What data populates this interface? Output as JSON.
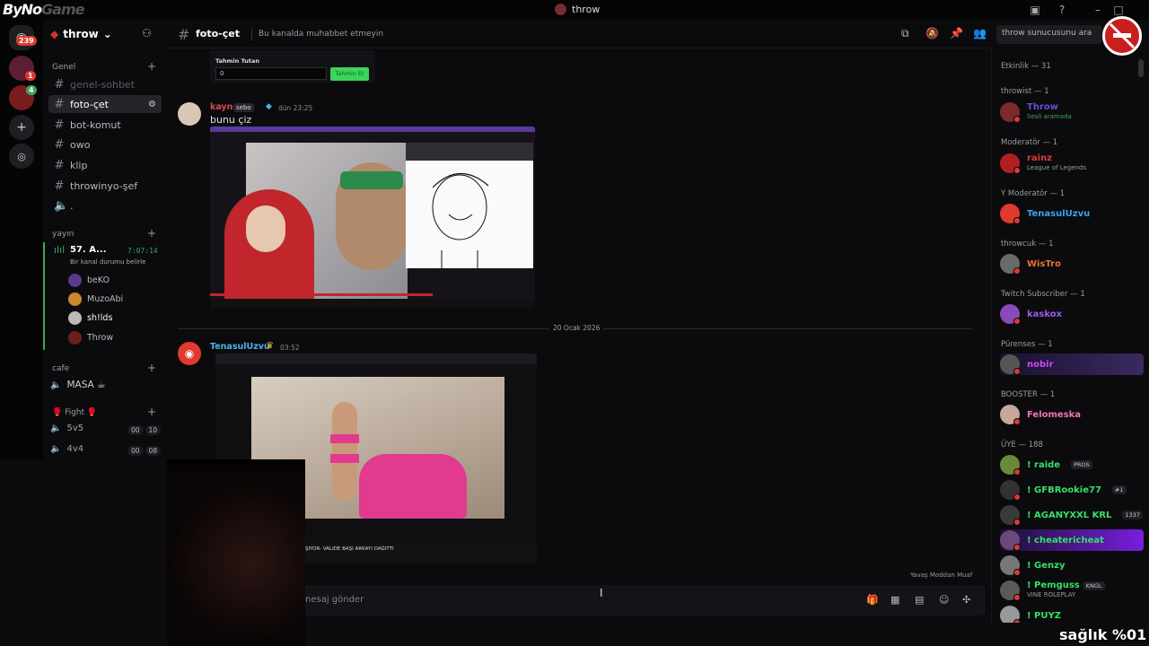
{
  "window": {
    "brand_main": "ByNo",
    "brand_game": "Game",
    "title": "throw"
  },
  "rail": {
    "home_badge": "239",
    "server2_badge": "1",
    "server3_badge": "4"
  },
  "guild": {
    "name": "throw",
    "chevron": "⌄"
  },
  "categories": {
    "genel": "Genel",
    "yayin": "yayın",
    "cafe": "cafe",
    "fight": "🥊 Fight 🥊"
  },
  "channels": [
    {
      "label": "genel-sohbet",
      "icon": "#",
      "state": "muted"
    },
    {
      "label": "foto-çet",
      "icon": "#",
      "state": "active"
    },
    {
      "label": "bot-komut",
      "icon": "#",
      "state": "normal"
    },
    {
      "label": "owo",
      "icon": "#",
      "state": "normal"
    },
    {
      "label": "klip",
      "icon": "#",
      "state": "normal"
    },
    {
      "label": "throwinyo-şef",
      "icon": "#",
      "state": "normal"
    },
    {
      "label": ".",
      "icon": "🔈",
      "state": "normal"
    }
  ],
  "voice_channel": {
    "name": "57. A...",
    "timer": "7:07:14",
    "status": "Bir kanal durumu belirle",
    "users": [
      "beKO",
      "MuzoAbi",
      "sh!lds",
      "Throw"
    ]
  },
  "cafe_channel": {
    "name": "MASA ☕"
  },
  "fight_channels": [
    {
      "name": "5v5",
      "count": "00",
      "limit": "10"
    },
    {
      "name": "4v4",
      "count": "00",
      "limit": "08"
    }
  ],
  "header": {
    "channel_name": "foto-çet",
    "topic": "Bu kanalda muhabbet etmeyin",
    "search_placeholder": "throw sunucusunu ara"
  },
  "game_card": {
    "label": "Tahmin Tutan",
    "input_value": "0",
    "button": "Tahmin Et"
  },
  "messages": [
    {
      "author": "kayn",
      "tag": "sebo",
      "time": "dün 23:25",
      "text": "bunu çiz"
    },
    {
      "author": "TenasulUzvu",
      "time": "03:52",
      "text": ""
    }
  ],
  "date_divider": "20 Ocak 2026",
  "embed2_caption": "ŞIYOR- VALIDE BAŞI ARKAYI DAĞITTI",
  "slowmode": "Yavaş Moddan Muaf",
  "composer": {
    "placeholder": "nesaj gönder"
  },
  "members": {
    "activity_head": "Etkinlik — 31",
    "groups": [
      {
        "head": "throwist — 1",
        "name": "Throw",
        "sub": "Sesli aramada",
        "color": "#6a4bd6"
      },
      {
        "head": "Moderatör — 1",
        "name": "rainz",
        "sub": "League of Legends",
        "color": "#d83b3b"
      },
      {
        "head": "Y Moderatör — 1",
        "name": "TenasulUzvu",
        "sub": "",
        "color": "#3fa3e8"
      },
      {
        "head": "throwcuk — 1",
        "name": "WisTro",
        "sub": "",
        "color": "#e8703a"
      },
      {
        "head": "Twitch Subscriber — 1",
        "name": "kaskox",
        "sub": "",
        "color": "#9a5cf0"
      },
      {
        "head": "Pürenses — 1",
        "name": "nobir",
        "sub": "",
        "color": "#c74cf2"
      },
      {
        "head": "BOOSTER — 1",
        "name": "Felomeska",
        "sub": "",
        "color": "#f273b8"
      }
    ],
    "uye_head": "ÜYE — 188",
    "uye": [
      {
        "name": "! raide",
        "chip": "PROS",
        "sub": ""
      },
      {
        "name": "! GFBRookie77",
        "chip": "#1",
        "sub": ""
      },
      {
        "name": "! AGANYXXL KRL",
        "chip": "1337",
        "sub": ""
      },
      {
        "name": "! cheatericheat",
        "chip": "",
        "sub": ""
      },
      {
        "name": "! Genzy",
        "chip": "",
        "sub": ""
      },
      {
        "name": "! Pemguss",
        "chip": "KNGL",
        "sub": "VINE ROLEPLAY"
      },
      {
        "name": "! PUYZ",
        "chip": "",
        "sub": ""
      }
    ]
  },
  "overlay": {
    "health_text": "sağlık %01"
  },
  "colors": {
    "accent_green": "#3dd35c",
    "kayn": "#d84a4a",
    "tenasul": "#4fb3e8",
    "uye_green": "#36e06a"
  }
}
